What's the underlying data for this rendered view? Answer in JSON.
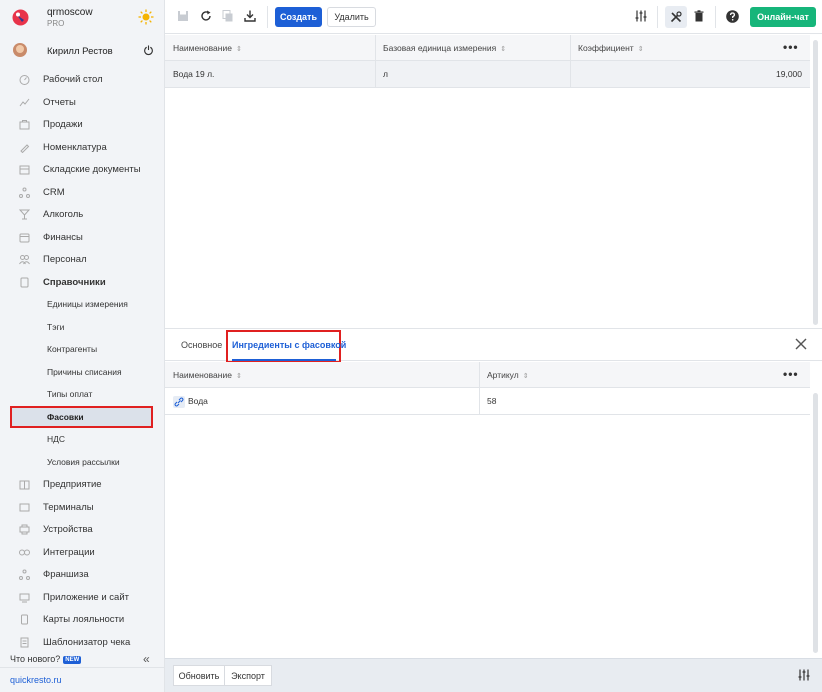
{
  "brand": {
    "name": "qrmoscow",
    "plan": "PRO"
  },
  "user": {
    "name": "Кирилл Рестов"
  },
  "menu": [
    {
      "label": "Рабочий стол",
      "icon": "dashboard-icon"
    },
    {
      "label": "Отчеты",
      "icon": "reports-icon"
    },
    {
      "label": "Продажи",
      "icon": "sales-icon"
    },
    {
      "label": "Номенклатура",
      "icon": "nomenclature-icon"
    },
    {
      "label": "Складские документы",
      "icon": "warehouse-icon"
    },
    {
      "label": "CRM",
      "icon": "crm-icon"
    },
    {
      "label": "Алкоголь",
      "icon": "alcohol-icon"
    },
    {
      "label": "Финансы",
      "icon": "finance-icon"
    },
    {
      "label": "Персонал",
      "icon": "staff-icon"
    },
    {
      "label": "Справочники",
      "icon": "reference-icon"
    }
  ],
  "submenu": [
    "Единицы измерения",
    "Тэги",
    "Контрагенты",
    "Причины списания",
    "Типы оплат",
    "Фасовки",
    "НДС",
    "Условия рассылки"
  ],
  "menu_bottom": [
    {
      "label": "Предприятие",
      "icon": "enterprise-icon"
    },
    {
      "label": "Терминалы",
      "icon": "terminal-icon"
    },
    {
      "label": "Устройства",
      "icon": "devices-icon"
    },
    {
      "label": "Интеграции",
      "icon": "integrations-icon"
    },
    {
      "label": "Франшиза",
      "icon": "franchise-icon"
    },
    {
      "label": "Приложение и сайт",
      "icon": "app-site-icon"
    },
    {
      "label": "Карты лояльности",
      "icon": "loyalty-card-icon"
    },
    {
      "label": "Шаблонизатор чека",
      "icon": "receipt-template-icon"
    }
  ],
  "sidebar_footer": {
    "whats_new": "Что нового?",
    "new_badge": "NEW",
    "collapse": "«",
    "site": "quickresto.ru"
  },
  "toolbar": {
    "create": "Создать",
    "delete": "Удалить",
    "chat": "Онлайн-чат"
  },
  "main_table": {
    "columns": [
      "Наименование",
      "Базовая единица измерения",
      "Коэффициент"
    ],
    "rows": [
      {
        "name": "Вода 19 л.",
        "unit": "л",
        "coef": "19,000"
      }
    ]
  },
  "tabs": {
    "basic": "Основное",
    "ingredients": "Ингредиенты с фасовкой"
  },
  "sub_table": {
    "columns": [
      "Наименование",
      "Артикул"
    ],
    "rows": [
      {
        "name": "Вода",
        "article": "58"
      }
    ]
  },
  "footer": {
    "refresh": "Обновить",
    "export": "Экспорт"
  },
  "colors": {
    "accent": "#1d5fd6",
    "chat": "#16b57a",
    "highlight": "#e02020"
  }
}
